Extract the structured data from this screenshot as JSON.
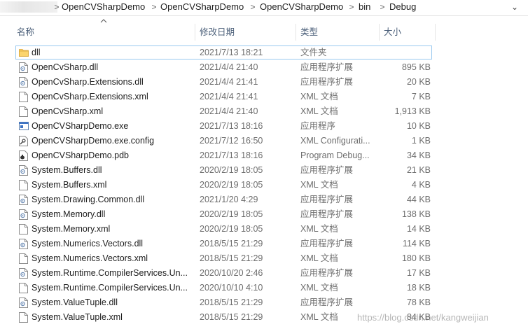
{
  "breadcrumb": {
    "items": [
      "OpenCVSharpDemo",
      "OpenCVSharpDemo",
      "OpenCVSharpDemo",
      "bin",
      "Debug"
    ],
    "separator": ">",
    "dropdown": "⌄"
  },
  "columns": {
    "name": "名称",
    "date": "修改日期",
    "type": "类型",
    "size": "大小"
  },
  "files": [
    {
      "name": "dll",
      "date": "2021/7/13 18:21",
      "type": "文件夹",
      "size": "",
      "icon": "folder-icon"
    },
    {
      "name": "OpenCvSharp.dll",
      "date": "2021/4/4 21:40",
      "type": "应用程序扩展",
      "size": "895 KB",
      "icon": "dll-file-icon"
    },
    {
      "name": "OpenCvSharp.Extensions.dll",
      "date": "2021/4/4 21:41",
      "type": "应用程序扩展",
      "size": "20 KB",
      "icon": "dll-file-icon"
    },
    {
      "name": "OpenCvSharp.Extensions.xml",
      "date": "2021/4/4 21:41",
      "type": "XML 文档",
      "size": "7 KB",
      "icon": "xml-file-icon"
    },
    {
      "name": "OpenCvSharp.xml",
      "date": "2021/4/4 21:40",
      "type": "XML 文档",
      "size": "1,913 KB",
      "icon": "xml-file-icon"
    },
    {
      "name": "OpenCVSharpDemo.exe",
      "date": "2021/7/13 18:16",
      "type": "应用程序",
      "size": "10 KB",
      "icon": "exe-file-icon"
    },
    {
      "name": "OpenCVSharpDemo.exe.config",
      "date": "2021/7/12 16:50",
      "type": "XML Configurati...",
      "size": "1 KB",
      "icon": "config-file-icon"
    },
    {
      "name": "OpenCVSharpDemo.pdb",
      "date": "2021/7/13 18:16",
      "type": "Program Debug...",
      "size": "34 KB",
      "icon": "pdb-file-icon"
    },
    {
      "name": "System.Buffers.dll",
      "date": "2020/2/19 18:05",
      "type": "应用程序扩展",
      "size": "21 KB",
      "icon": "dll-file-icon"
    },
    {
      "name": "System.Buffers.xml",
      "date": "2020/2/19 18:05",
      "type": "XML 文档",
      "size": "4 KB",
      "icon": "xml-file-icon"
    },
    {
      "name": "System.Drawing.Common.dll",
      "date": "2021/1/20 4:29",
      "type": "应用程序扩展",
      "size": "44 KB",
      "icon": "dll-file-icon"
    },
    {
      "name": "System.Memory.dll",
      "date": "2020/2/19 18:05",
      "type": "应用程序扩展",
      "size": "138 KB",
      "icon": "dll-file-icon"
    },
    {
      "name": "System.Memory.xml",
      "date": "2020/2/19 18:05",
      "type": "XML 文档",
      "size": "14 KB",
      "icon": "xml-file-icon"
    },
    {
      "name": "System.Numerics.Vectors.dll",
      "date": "2018/5/15 21:29",
      "type": "应用程序扩展",
      "size": "114 KB",
      "icon": "dll-file-icon"
    },
    {
      "name": "System.Numerics.Vectors.xml",
      "date": "2018/5/15 21:29",
      "type": "XML 文档",
      "size": "180 KB",
      "icon": "xml-file-icon"
    },
    {
      "name": "System.Runtime.CompilerServices.Un...",
      "date": "2020/10/20 2:46",
      "type": "应用程序扩展",
      "size": "17 KB",
      "icon": "dll-file-icon"
    },
    {
      "name": "System.Runtime.CompilerServices.Un...",
      "date": "2020/10/10 4:10",
      "type": "XML 文档",
      "size": "18 KB",
      "icon": "xml-file-icon"
    },
    {
      "name": "System.ValueTuple.dll",
      "date": "2018/5/15 21:29",
      "type": "应用程序扩展",
      "size": "78 KB",
      "icon": "dll-file-icon"
    },
    {
      "name": "System.ValueTuple.xml",
      "date": "2018/5/15 21:29",
      "type": "XML 文档",
      "size": "84 KB",
      "icon": "xml-file-icon"
    }
  ],
  "watermark": "https://blog.csdn.net/kangweijian",
  "colors": {
    "header_text": "#4c607a",
    "folder": "#f7c95c",
    "focus_border": "#99c9ef",
    "secondary_text": "#6d6d6d"
  }
}
